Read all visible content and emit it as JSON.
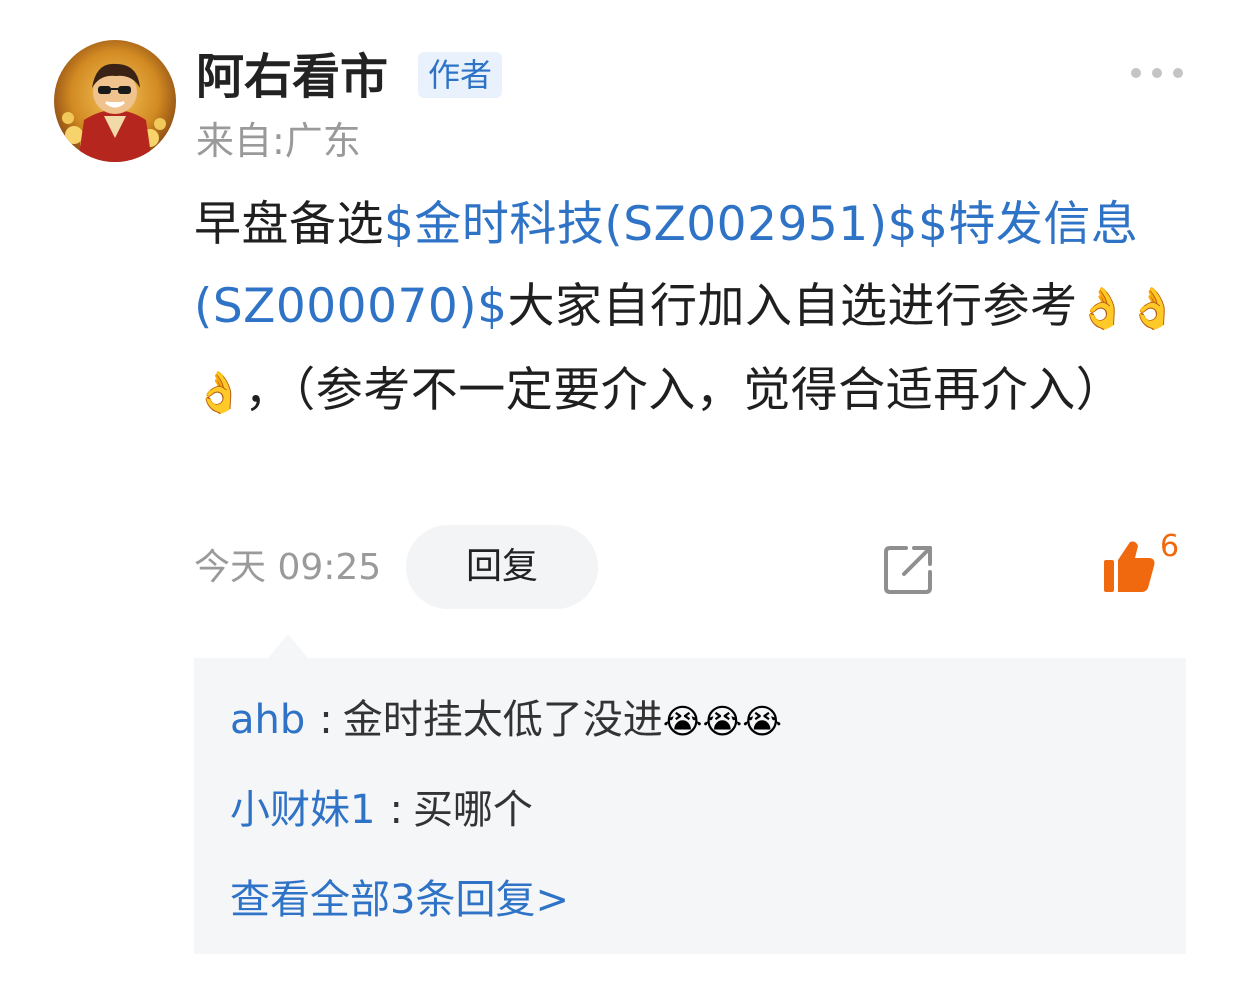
{
  "post": {
    "author": "阿右看市",
    "badge": "作者",
    "location": "来自:广东",
    "text_1": "早盘备选",
    "stock_1": "$金时科技(SZ002951)$",
    "stock_2": "$特发信息(SZ000070)$",
    "text_2": "大家自行加入自选进行参考",
    "emoji_1": "👌",
    "emoji_2": "👌👌",
    "text_3": "，（参考不一定要介入，觉得合适再介入）",
    "time": "今天 09:25",
    "reply_label": "回复",
    "like_count": "6"
  },
  "replies": {
    "items": [
      {
        "author": "ahb",
        "sep": ":",
        "text": "金时挂太低了没进",
        "emoji": "😭😭😭"
      },
      {
        "author": "小财妹1",
        "sep": ":",
        "text": "买哪个",
        "emoji": ""
      }
    ],
    "view_all": "查看全部3条回复>"
  },
  "colors": {
    "link": "#2f73c7",
    "like": "#f0690f",
    "muted": "#9a9a9a",
    "reply_bg": "#f5f6f8"
  },
  "icons": [
    "avatar",
    "more-icon",
    "share-icon",
    "thumbs-up-icon"
  ]
}
